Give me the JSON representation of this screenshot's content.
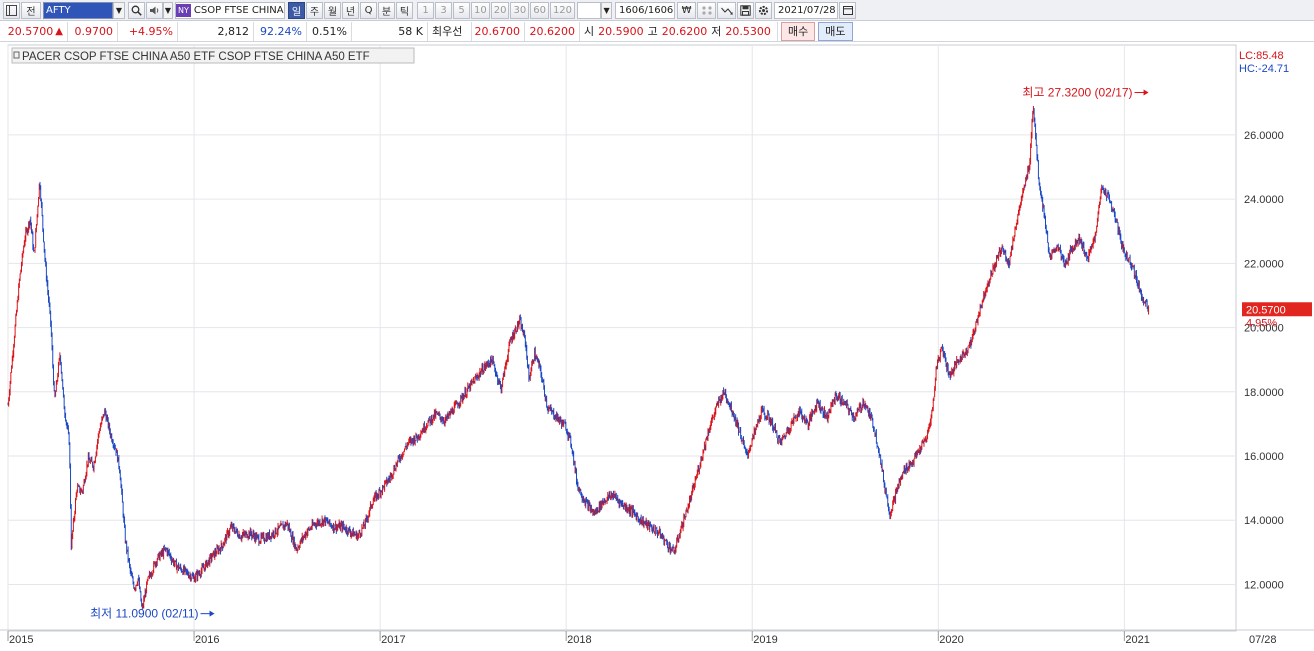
{
  "toolbar": {
    "mode_label": "전",
    "symbol": "AFTY",
    "exchange_badge": "NY",
    "name": "CSOP FTSE CHINA",
    "periods": [
      "일",
      "주",
      "월",
      "년",
      "Q",
      "분",
      "틱"
    ],
    "intervals": [
      "1",
      "3",
      "5",
      "10",
      "20",
      "30",
      "60",
      "120"
    ],
    "interval_value": "",
    "count": "1606/1606",
    "won_label": "₩",
    "date": "2021/07/28"
  },
  "quote": {
    "price": "20.5700",
    "change": "0.9700",
    "change_pct": "+4.95%",
    "volume": "2,812",
    "volume_ratio": "92.24%",
    "turnover": "0.51%",
    "amount": "58 K",
    "best_bid_label": "최우선",
    "best_ask": "20.6700",
    "best_bid": "20.6200",
    "open_label": "시",
    "open": "20.5900",
    "high_label": "고",
    "high": "20.6200",
    "low_label": "저",
    "low": "20.5300",
    "buy_label": "매수",
    "sell_label": "매도"
  },
  "chart": {
    "title": "PACER CSOP FTSE CHINA A50 ETF  CSOP FTSE CHINA A50 ETF",
    "lc_label": "LC:85.48",
    "hc_label": "HC:-24.71",
    "high_annotation": "최고 27.3200 (02/17)",
    "low_annotation": "최저 11.0900 (02/11)",
    "current_price_tag": "20.5700",
    "current_pct_tag": "4.95%",
    "last_date_label": "07/28",
    "up_color": "#d8141a",
    "down_color": "#1b48c4"
  },
  "chart_data": {
    "type": "candlestick",
    "y_ticks": [
      "12.0000",
      "14.0000",
      "16.0000",
      "18.0000",
      "20.0000",
      "22.0000",
      "24.0000",
      "26.0000"
    ],
    "y_tick_values": [
      12,
      14,
      16,
      18,
      20,
      22,
      24,
      26
    ],
    "x_labels": [
      "2015",
      "2016",
      "2017",
      "2018",
      "2019",
      "2020",
      "2021"
    ],
    "x_label_times": [
      2015.0,
      2016.0,
      2017.0,
      2018.0,
      2019.0,
      2020.0,
      2021.0
    ],
    "ylim": [
      10.55,
      28.8
    ],
    "xlim": [
      2015.0,
      2021.6
    ],
    "high": {
      "x": 2021.13,
      "value": 27.32
    },
    "low": {
      "x": 2016.11,
      "value": 11.09
    },
    "last": {
      "x": 2021.57,
      "value": 20.57
    },
    "path": [
      [
        2015.0,
        17.6
      ],
      [
        2015.03,
        19.5
      ],
      [
        2015.06,
        21.4
      ],
      [
        2015.09,
        22.8
      ],
      [
        2015.12,
        23.4
      ],
      [
        2015.14,
        22.2
      ],
      [
        2015.17,
        24.6
      ],
      [
        2015.2,
        22.0
      ],
      [
        2015.23,
        20.1
      ],
      [
        2015.25,
        17.7
      ],
      [
        2015.28,
        19.2
      ],
      [
        2015.3,
        17.6
      ],
      [
        2015.33,
        16.4
      ],
      [
        2015.34,
        13.2
      ],
      [
        2015.37,
        15.0
      ],
      [
        2015.4,
        14.9
      ],
      [
        2015.43,
        15.9
      ],
      [
        2015.46,
        15.7
      ],
      [
        2015.49,
        16.8
      ],
      [
        2015.52,
        17.4
      ],
      [
        2015.55,
        16.7
      ],
      [
        2015.58,
        16.2
      ],
      [
        2015.6,
        15.6
      ],
      [
        2015.63,
        13.4
      ],
      [
        2015.66,
        12.3
      ],
      [
        2015.68,
        11.9
      ],
      [
        2015.7,
        12.2
      ],
      [
        2015.72,
        11.2
      ],
      [
        2015.75,
        12.1
      ],
      [
        2015.8,
        12.8
      ],
      [
        2015.85,
        13.1
      ],
      [
        2015.9,
        12.6
      ],
      [
        2015.95,
        12.4
      ],
      [
        2016.0,
        12.2
      ],
      [
        2016.05,
        12.5
      ],
      [
        2016.1,
        12.9
      ],
      [
        2016.15,
        13.2
      ],
      [
        2016.2,
        13.8
      ],
      [
        2016.25,
        13.5
      ],
      [
        2016.3,
        13.6
      ],
      [
        2016.35,
        13.4
      ],
      [
        2016.4,
        13.5
      ],
      [
        2016.45,
        13.7
      ],
      [
        2016.5,
        13.9
      ],
      [
        2016.55,
        13.1
      ],
      [
        2016.6,
        13.6
      ],
      [
        2016.65,
        13.9
      ],
      [
        2016.7,
        14.0
      ],
      [
        2016.75,
        13.8
      ],
      [
        2016.8,
        13.8
      ],
      [
        2016.85,
        13.6
      ],
      [
        2016.88,
        13.5
      ],
      [
        2016.92,
        13.9
      ],
      [
        2016.96,
        14.6
      ],
      [
        2017.0,
        14.9
      ],
      [
        2017.05,
        15.3
      ],
      [
        2017.1,
        15.9
      ],
      [
        2017.15,
        16.4
      ],
      [
        2017.2,
        16.6
      ],
      [
        2017.25,
        17.0
      ],
      [
        2017.3,
        17.3
      ],
      [
        2017.35,
        17.1
      ],
      [
        2017.4,
        17.5
      ],
      [
        2017.45,
        17.9
      ],
      [
        2017.5,
        18.3
      ],
      [
        2017.55,
        18.7
      ],
      [
        2017.6,
        19.0
      ],
      [
        2017.65,
        18.1
      ],
      [
        2017.7,
        19.6
      ],
      [
        2017.75,
        20.2
      ],
      [
        2017.78,
        19.6
      ],
      [
        2017.8,
        18.4
      ],
      [
        2017.83,
        19.2
      ],
      [
        2017.86,
        18.7
      ],
      [
        2017.9,
        17.5
      ],
      [
        2017.95,
        17.2
      ],
      [
        2018.0,
        16.9
      ],
      [
        2018.03,
        16.3
      ],
      [
        2018.06,
        15.1
      ],
      [
        2018.1,
        14.6
      ],
      [
        2018.15,
        14.2
      ],
      [
        2018.2,
        14.6
      ],
      [
        2018.25,
        14.8
      ],
      [
        2018.3,
        14.5
      ],
      [
        2018.35,
        14.3
      ],
      [
        2018.4,
        14.0
      ],
      [
        2018.45,
        13.8
      ],
      [
        2018.5,
        13.6
      ],
      [
        2018.55,
        13.2
      ],
      [
        2018.58,
        13.0
      ],
      [
        2018.62,
        13.8
      ],
      [
        2018.67,
        14.7
      ],
      [
        2018.72,
        15.8
      ],
      [
        2018.77,
        16.9
      ],
      [
        2018.82,
        17.7
      ],
      [
        2018.85,
        18.0
      ],
      [
        2018.9,
        17.3
      ],
      [
        2018.93,
        16.8
      ],
      [
        2018.97,
        16.0
      ],
      [
        2019.0,
        16.5
      ],
      [
        2019.05,
        17.4
      ],
      [
        2019.1,
        17.1
      ],
      [
        2019.15,
        16.4
      ],
      [
        2019.2,
        16.9
      ],
      [
        2019.25,
        17.4
      ],
      [
        2019.3,
        17.0
      ],
      [
        2019.35,
        17.7
      ],
      [
        2019.4,
        17.2
      ],
      [
        2019.45,
        17.9
      ],
      [
        2019.5,
        17.6
      ],
      [
        2019.55,
        17.2
      ],
      [
        2019.6,
        17.7
      ],
      [
        2019.65,
        17.0
      ],
      [
        2019.68,
        16.2
      ],
      [
        2019.71,
        15.1
      ],
      [
        2019.74,
        14.2
      ],
      [
        2019.78,
        15.0
      ],
      [
        2019.82,
        15.6
      ],
      [
        2019.86,
        15.8
      ],
      [
        2019.9,
        16.2
      ],
      [
        2019.94,
        16.6
      ],
      [
        2019.97,
        17.5
      ],
      [
        2019.99,
        18.8
      ],
      [
        2020.02,
        19.4
      ],
      [
        2020.06,
        18.5
      ],
      [
        2020.1,
        18.9
      ],
      [
        2020.14,
        19.2
      ],
      [
        2020.18,
        19.6
      ],
      [
        2020.22,
        20.5
      ],
      [
        2020.26,
        21.3
      ],
      [
        2020.3,
        21.9
      ],
      [
        2020.34,
        22.5
      ],
      [
        2020.38,
        22.0
      ],
      [
        2020.42,
        23.3
      ],
      [
        2020.46,
        24.3
      ],
      [
        2020.49,
        25.1
      ],
      [
        2020.51,
        27.0
      ],
      [
        2020.54,
        24.6
      ],
      [
        2020.57,
        23.5
      ],
      [
        2020.6,
        22.1
      ],
      [
        2020.64,
        22.6
      ],
      [
        2020.68,
        21.9
      ],
      [
        2020.72,
        22.5
      ],
      [
        2020.76,
        22.8
      ],
      [
        2020.8,
        22.1
      ],
      [
        2020.84,
        22.8
      ],
      [
        2020.88,
        24.4
      ],
      [
        2020.92,
        24.0
      ],
      [
        2020.96,
        23.2
      ],
      [
        2021.0,
        22.3
      ],
      [
        2021.04,
        22.0
      ],
      [
        2021.07,
        21.4
      ],
      [
        2021.1,
        20.9
      ],
      [
        2021.13,
        20.57
      ]
    ]
  }
}
